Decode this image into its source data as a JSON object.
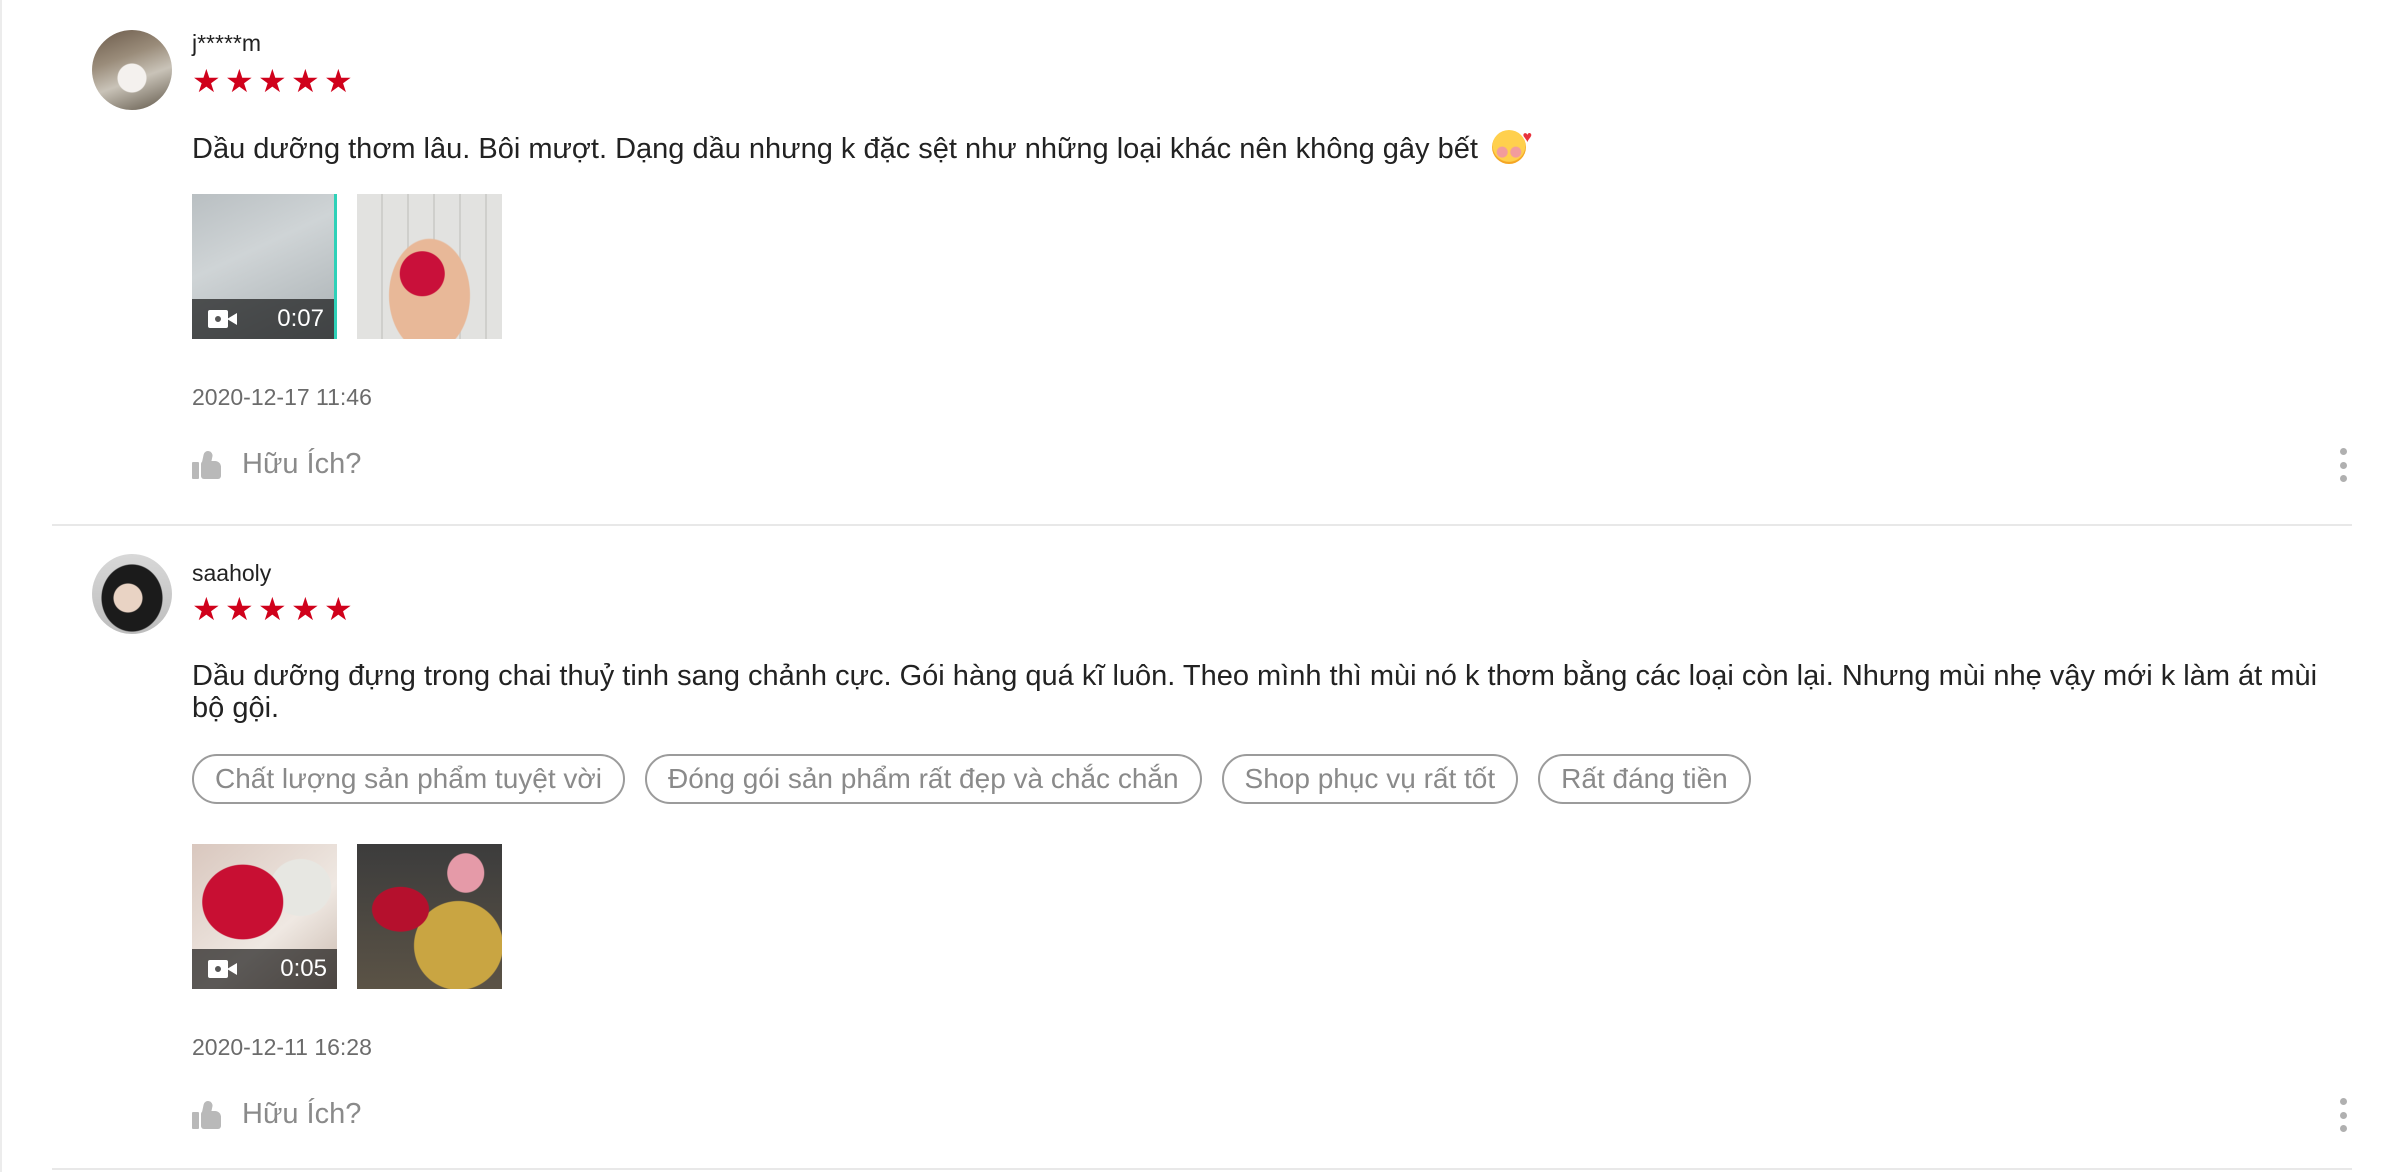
{
  "reviews": [
    {
      "username": "j*****m",
      "avatar_icon": "user-avatar",
      "rating": 5,
      "rating_color": "#d0011b",
      "comment": "Dầu dưỡng thơm lâu. Bôi mượt. Dạng dầu nhưng k đặc sệt như những loại khác nên không gây bết",
      "comment_emoji": "smiling-face-with-hearts-emoji",
      "tags": [],
      "media": [
        {
          "type": "video",
          "duration": "0:07"
        },
        {
          "type": "photo"
        }
      ],
      "timestamp": "2020-12-17 11:46",
      "helpful_label": "Hữu Ích?"
    },
    {
      "username": "saaholy",
      "avatar_icon": "user-avatar",
      "rating": 5,
      "rating_color": "#d0011b",
      "comment": "Dầu dưỡng đựng trong chai thuỷ tinh sang chảnh cực. Gói hàng quá kĩ luôn. Theo mình thì mùi nó k thơm bằng các loại còn lại. Nhưng mùi nhẹ vậy mới k làm át mùi bộ gội.",
      "tags": [
        "Chất lượng sản phẩm tuyệt vời",
        "Đóng gói sản phẩm rất đẹp và chắc chắn",
        "Shop phục vụ rất tốt",
        "Rất đáng tiền"
      ],
      "media": [
        {
          "type": "video",
          "duration": "0:05"
        },
        {
          "type": "photo"
        }
      ],
      "timestamp": "2020-12-11 16:28",
      "helpful_label": "Hữu Ích?"
    }
  ],
  "star_glyph": "★",
  "icons": {
    "helpful": "thumbs-up-icon",
    "more": "more-vertical-icon",
    "video": "video-camera-icon"
  }
}
